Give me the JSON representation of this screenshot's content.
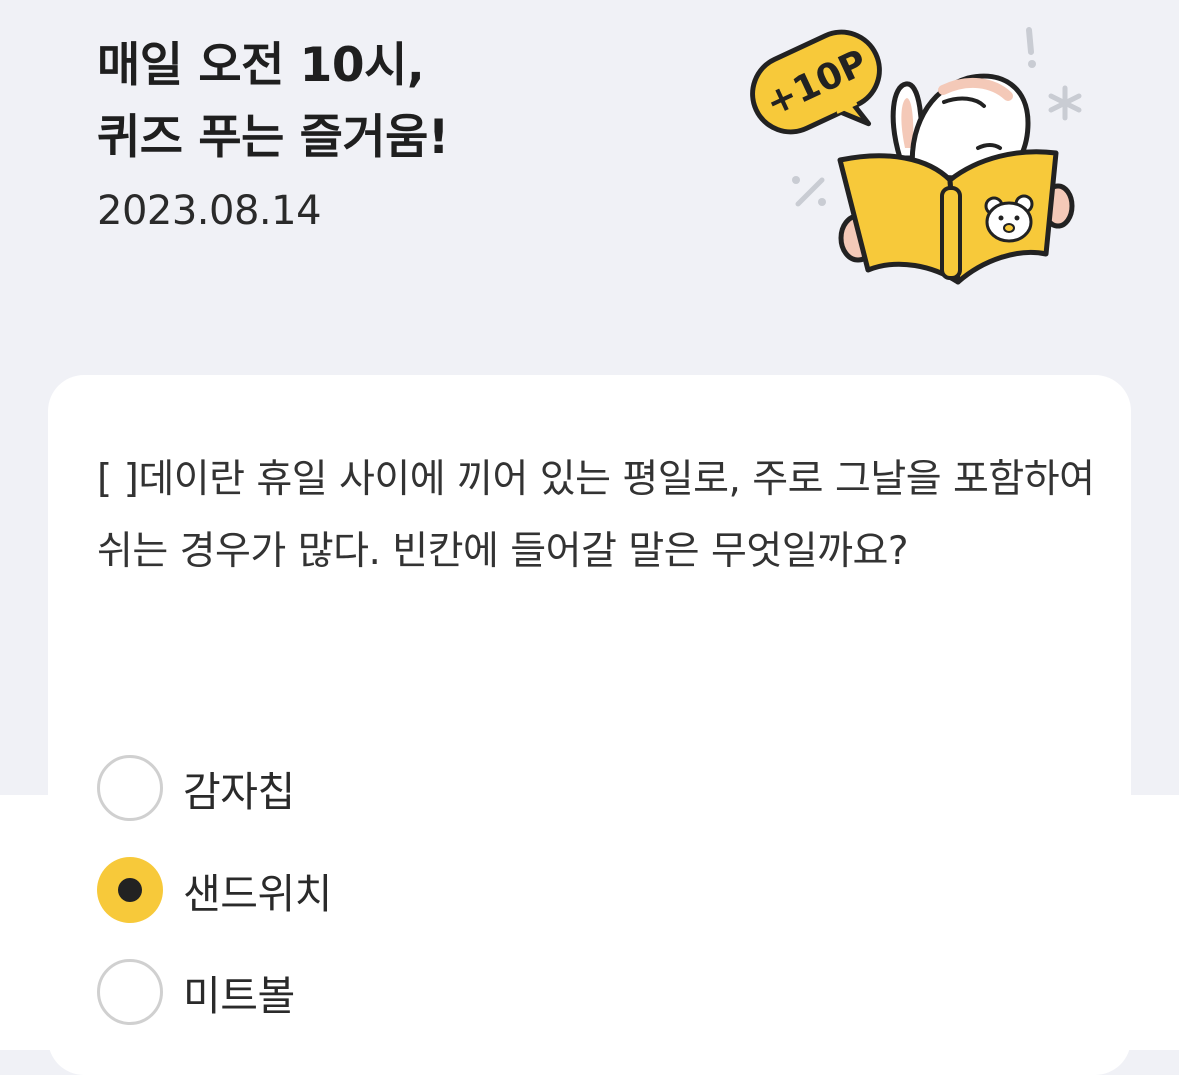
{
  "header": {
    "title_line1": "매일 오전 10시,",
    "title_line2": "퀴즈 푸는 즐거움!",
    "date": "2023.08.14"
  },
  "illustration": {
    "badge_text": "+10P",
    "icon": "rabbit-reading-book"
  },
  "quiz": {
    "question": "[ ]데이란 휴일 사이에 끼어 있는 평일로, 주로 그날을 포함하여 쉬는 경우가 많다. 빈칸에 들어갈 말은 무엇일까요?",
    "options": [
      {
        "label": "감자칩",
        "selected": false
      },
      {
        "label": "샌드위치",
        "selected": true
      },
      {
        "label": "미트볼",
        "selected": false
      }
    ]
  },
  "colors": {
    "background": "#f0f1f6",
    "accent_yellow": "#f7c93a",
    "card": "#ffffff"
  }
}
